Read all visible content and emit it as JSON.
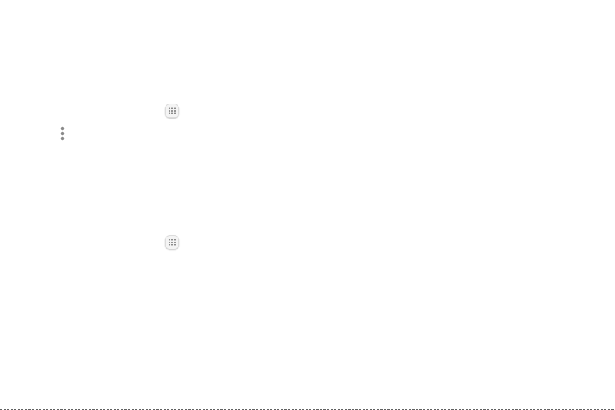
{
  "icons": {
    "apps_first": "apps-grid-icon",
    "more_options": "more-vertical-icon",
    "apps_second": "apps-grid-icon"
  },
  "colors": {
    "background": "#ffffff",
    "icon_dots": "#8a8a8a",
    "apps_button_fill": "#f4f4f4"
  }
}
